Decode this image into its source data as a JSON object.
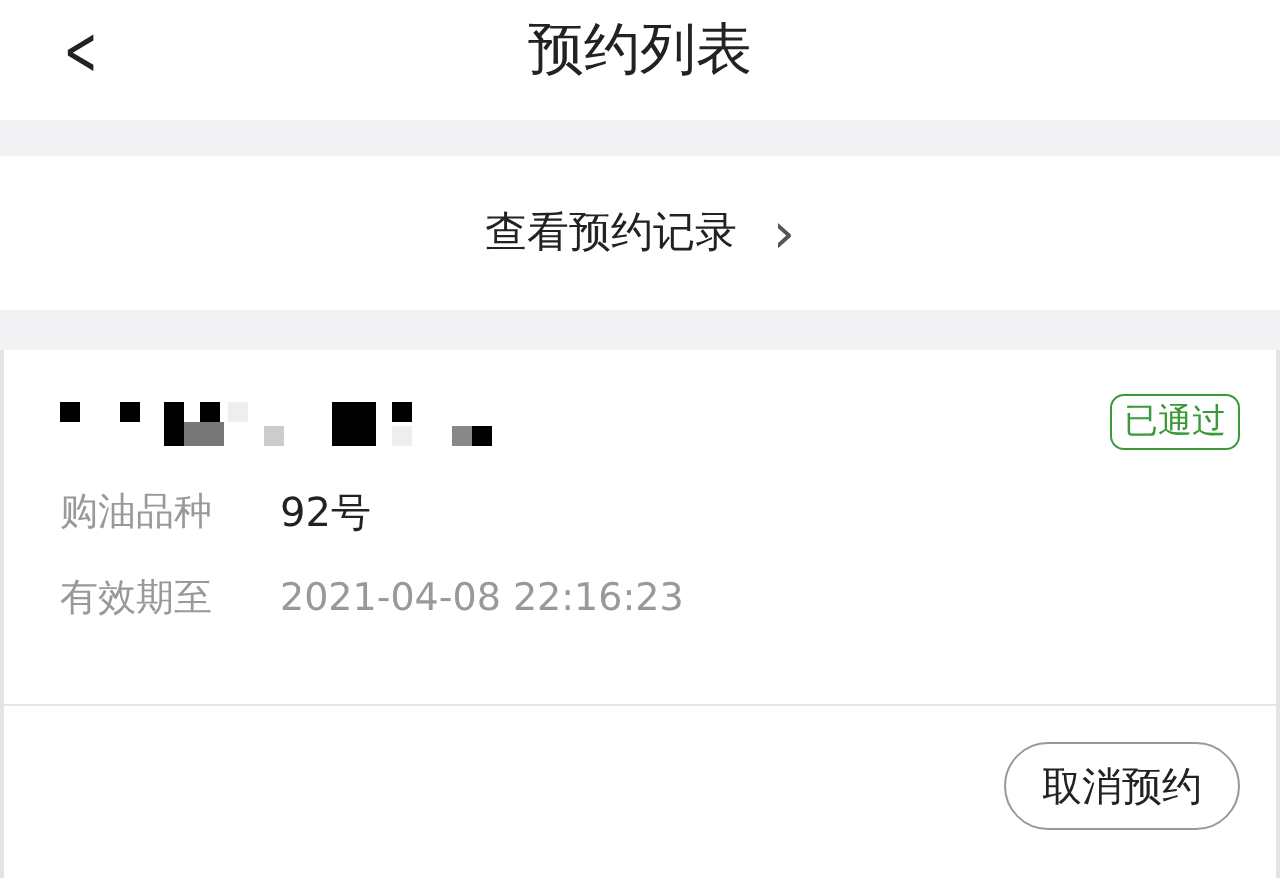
{
  "header": {
    "back": "<",
    "title": "预约列表"
  },
  "records_link": {
    "label": "查看预约记录",
    "chevron": "›"
  },
  "reservation": {
    "status": "已通过",
    "fields": [
      {
        "label": "购油品种",
        "value": "92号",
        "kind": "strong"
      },
      {
        "label": "有效期至",
        "value": "2021-04-08 22:16:23",
        "kind": "muted"
      }
    ],
    "action": "取消预约"
  }
}
